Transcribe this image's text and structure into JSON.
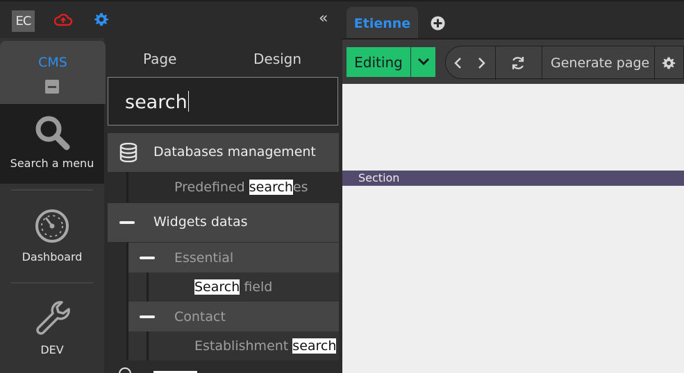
{
  "topbar": {
    "avatar_initials": "EC",
    "cloud_icon": "cloud-upload-icon",
    "cloud_color": "#e02020",
    "settings_icon": "gear-icon",
    "settings_color": "#2e8ff0",
    "collapse_glyph": "«"
  },
  "tabs": {
    "active_label": "Etienne",
    "add_icon": "plus-circle-icon"
  },
  "rail": {
    "cms_label": "CMS",
    "items": [
      {
        "label": "Search a menu",
        "icon": "search-icon"
      },
      {
        "label": "Dashboard",
        "icon": "gauge-icon"
      },
      {
        "label": "DEV",
        "icon": "wrench-icon"
      }
    ]
  },
  "panel": {
    "tabs": [
      "Page",
      "Design"
    ],
    "search_value": "search",
    "results": {
      "databases": "Databases management",
      "predefined_pre": "Predefined ",
      "predefined_hl": "search",
      "predefined_post": "es",
      "widgets": "Widgets datas",
      "essential": "Essential",
      "search_field_hl": "Search",
      "search_field_post": " field",
      "contact": "Contact",
      "establishment_pre": "Establishment ",
      "establishment_hl": "search"
    }
  },
  "toolbar": {
    "mode_label": "Editing",
    "generate_label": "Generate page",
    "accent": "#20c06c"
  },
  "canvas": {
    "section_label": "Section"
  }
}
